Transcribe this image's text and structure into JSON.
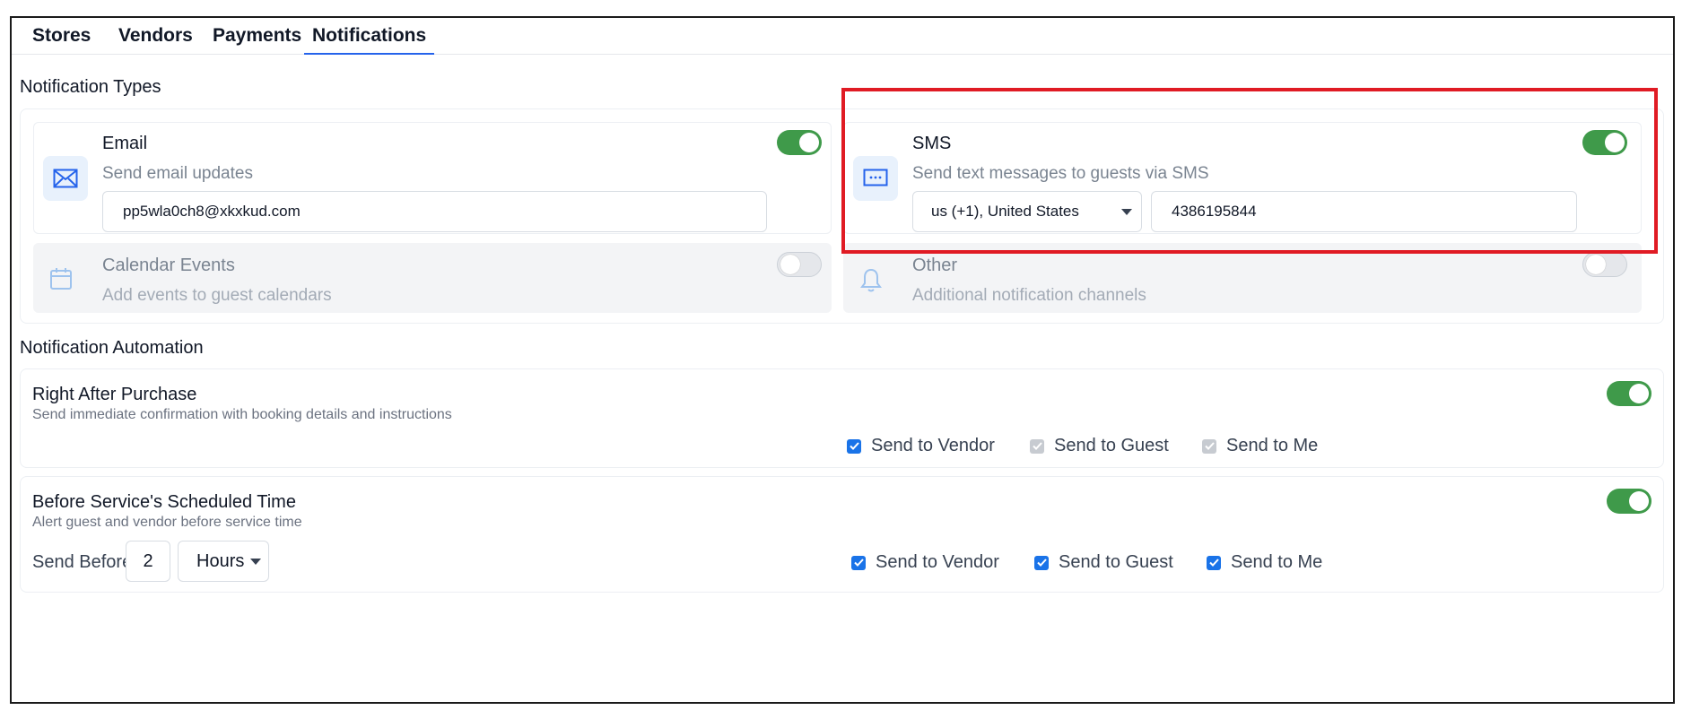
{
  "tabs": [
    {
      "label": "Stores"
    },
    {
      "label": "Vendors"
    },
    {
      "label": "Payments"
    },
    {
      "label": "Notifications",
      "active": true
    }
  ],
  "notification_types": {
    "title": "Notification Types",
    "email": {
      "title": "Email",
      "description": "Send email updates",
      "value": "pp5wla0ch8@xkxkud.com",
      "enabled": true,
      "icon": "envelope-icon"
    },
    "sms": {
      "title": "SMS",
      "description": "Send text messages to guests via SMS",
      "country": "us (+1), United States",
      "phone": "4386195844",
      "enabled": true,
      "icon": "message-icon"
    },
    "calendar": {
      "title": "Calendar Events",
      "description": "Add events to guest calendars",
      "enabled": false,
      "icon": "calendar-icon"
    },
    "other": {
      "title": "Other",
      "description": "Additional notification channels",
      "enabled": false,
      "icon": "bell-icon"
    }
  },
  "automation": {
    "title": "Notification Automation",
    "after_purchase": {
      "title": "Right After Purchase",
      "description": "Send immediate confirmation with booking details and instructions",
      "enabled": true,
      "send_to_vendor": {
        "label": "Send to Vendor",
        "checked": true
      },
      "send_to_guest": {
        "label": "Send to Guest",
        "checked": true,
        "disabled": true
      },
      "send_to_me": {
        "label": "Send to Me",
        "checked": true,
        "disabled": true
      }
    },
    "before_service": {
      "title": "Before Service's Scheduled Time",
      "description": "Alert guest and vendor before service time",
      "enabled": true,
      "send_before_label": "Send Before:",
      "send_before_value": "2",
      "unit": "Hours",
      "send_to_vendor": {
        "label": "Send to Vendor",
        "checked": true
      },
      "send_to_guest": {
        "label": "Send to Guest",
        "checked": true
      },
      "send_to_me": {
        "label": "Send to Me",
        "checked": true
      }
    }
  },
  "colors": {
    "toggle_on": "#3f9a4a",
    "checkbox": "#1a73e8",
    "highlight": "#e01b24",
    "tab_underline": "#2563eb"
  }
}
